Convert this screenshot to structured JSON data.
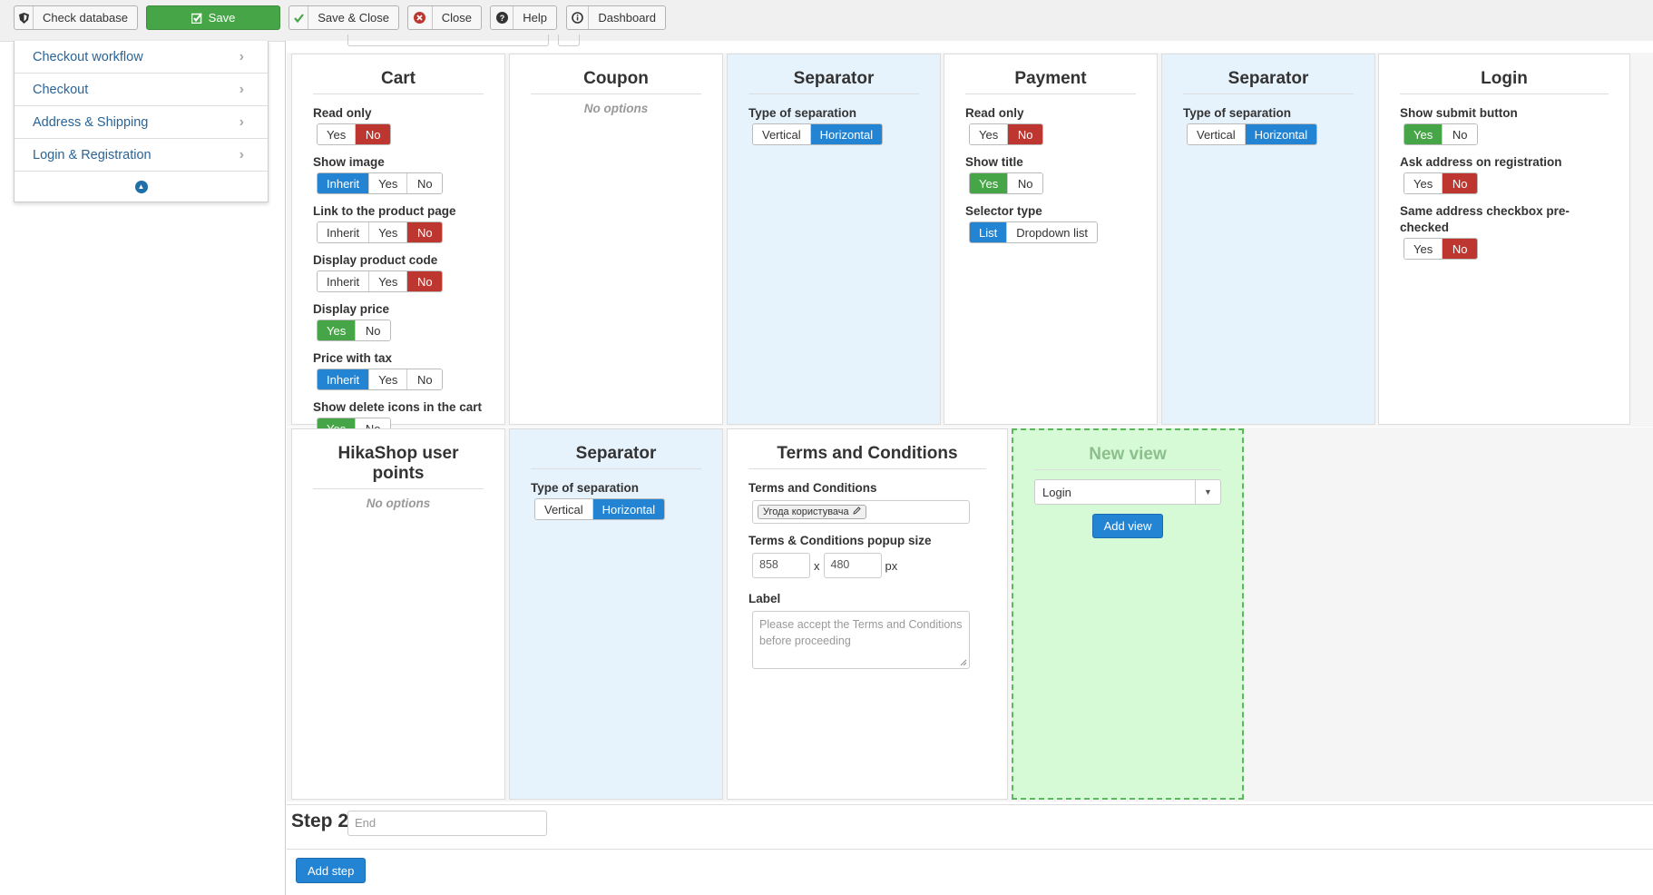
{
  "toolbar": {
    "buttons": [
      {
        "label": "Check database",
        "icon": "shield-icon"
      },
      {
        "label": "Save",
        "icon": "edit-check-icon"
      },
      {
        "label": "Save & Close",
        "icon": "check-icon"
      },
      {
        "label": "Close",
        "icon": "close-circle-icon"
      },
      {
        "label": "Help",
        "icon": "question-circle-icon"
      },
      {
        "label": "Dashboard",
        "icon": "info-circle-icon"
      }
    ]
  },
  "sidebar": {
    "items": [
      {
        "label": "Checkout workflow"
      },
      {
        "label": "Checkout"
      },
      {
        "label": "Address & Shipping"
      },
      {
        "label": "Login & Registration"
      }
    ],
    "collapse_icon": "chevron-up-circle-icon"
  },
  "cards": {
    "cart": {
      "title": "Cart",
      "fields": [
        {
          "label": "Read only",
          "options": [
            "Yes",
            "No"
          ],
          "selected": "No"
        },
        {
          "label": "Show image",
          "options": [
            "Inherit",
            "Yes",
            "No"
          ],
          "selected": "Inherit"
        },
        {
          "label": "Link to the product page",
          "options": [
            "Inherit",
            "Yes",
            "No"
          ],
          "selected": "No"
        },
        {
          "label": "Display product code",
          "options": [
            "Inherit",
            "Yes",
            "No"
          ],
          "selected": "No"
        },
        {
          "label": "Display price",
          "options": [
            "Yes",
            "No"
          ],
          "selected": "Yes"
        },
        {
          "label": "Price with tax",
          "options": [
            "Inherit",
            "Yes",
            "No"
          ],
          "selected": "Inherit"
        },
        {
          "label": "Show delete icons in the cart",
          "options": [
            "Yes",
            "No"
          ],
          "selected": "Yes"
        }
      ]
    },
    "coupon": {
      "title": "Coupon",
      "no_options": "No options"
    },
    "separator1": {
      "title": "Separator",
      "fields": [
        {
          "label": "Type of separation",
          "options": [
            "Vertical",
            "Horizontal"
          ],
          "selected": "Horizontal"
        }
      ]
    },
    "payment": {
      "title": "Payment",
      "fields": [
        {
          "label": "Read only",
          "options": [
            "Yes",
            "No"
          ],
          "selected": "No"
        },
        {
          "label": "Show title",
          "options": [
            "Yes",
            "No"
          ],
          "selected": "Yes"
        },
        {
          "label": "Selector type",
          "options": [
            "List",
            "Dropdown list"
          ],
          "selected": "List"
        }
      ]
    },
    "separator2": {
      "title": "Separator",
      "fields": [
        {
          "label": "Type of separation",
          "options": [
            "Vertical",
            "Horizontal"
          ],
          "selected": "Horizontal"
        }
      ]
    },
    "login": {
      "title": "Login",
      "fields": [
        {
          "label": "Show submit button",
          "options": [
            "Yes",
            "No"
          ],
          "selected": "Yes"
        },
        {
          "label": "Ask address on registration",
          "options": [
            "Yes",
            "No"
          ],
          "selected": "No"
        },
        {
          "label": "Same address checkbox pre-checked",
          "options": [
            "Yes",
            "No"
          ],
          "selected": "No"
        }
      ]
    },
    "userpoints": {
      "title": "HikaShop user points",
      "no_options": "No options"
    },
    "separator3": {
      "title": "Separator",
      "fields": [
        {
          "label": "Type of separation",
          "options": [
            "Vertical",
            "Horizontal"
          ],
          "selected": "Horizontal"
        }
      ]
    },
    "terms": {
      "title": "Terms and Conditions",
      "terms_label": "Terms and Conditions",
      "terms_tag": "Угода користувача",
      "popup_label": "Terms & Conditions popup size",
      "width": "858",
      "height": "480",
      "x": "x",
      "unit": "px",
      "label_label": "Label",
      "label_placeholder": "Please accept the Terms and Conditions before proceeding"
    },
    "newview": {
      "title": "New view",
      "select_value": "Login",
      "add_label": "Add view"
    }
  },
  "step2": {
    "label": "Step 2",
    "placeholder": "End"
  },
  "add_step_label": "Add step",
  "colors": {
    "red": "#bd362f",
    "green": "#46a546",
    "blue": "#2384d3",
    "new_view_bg": "#d6fad6"
  }
}
